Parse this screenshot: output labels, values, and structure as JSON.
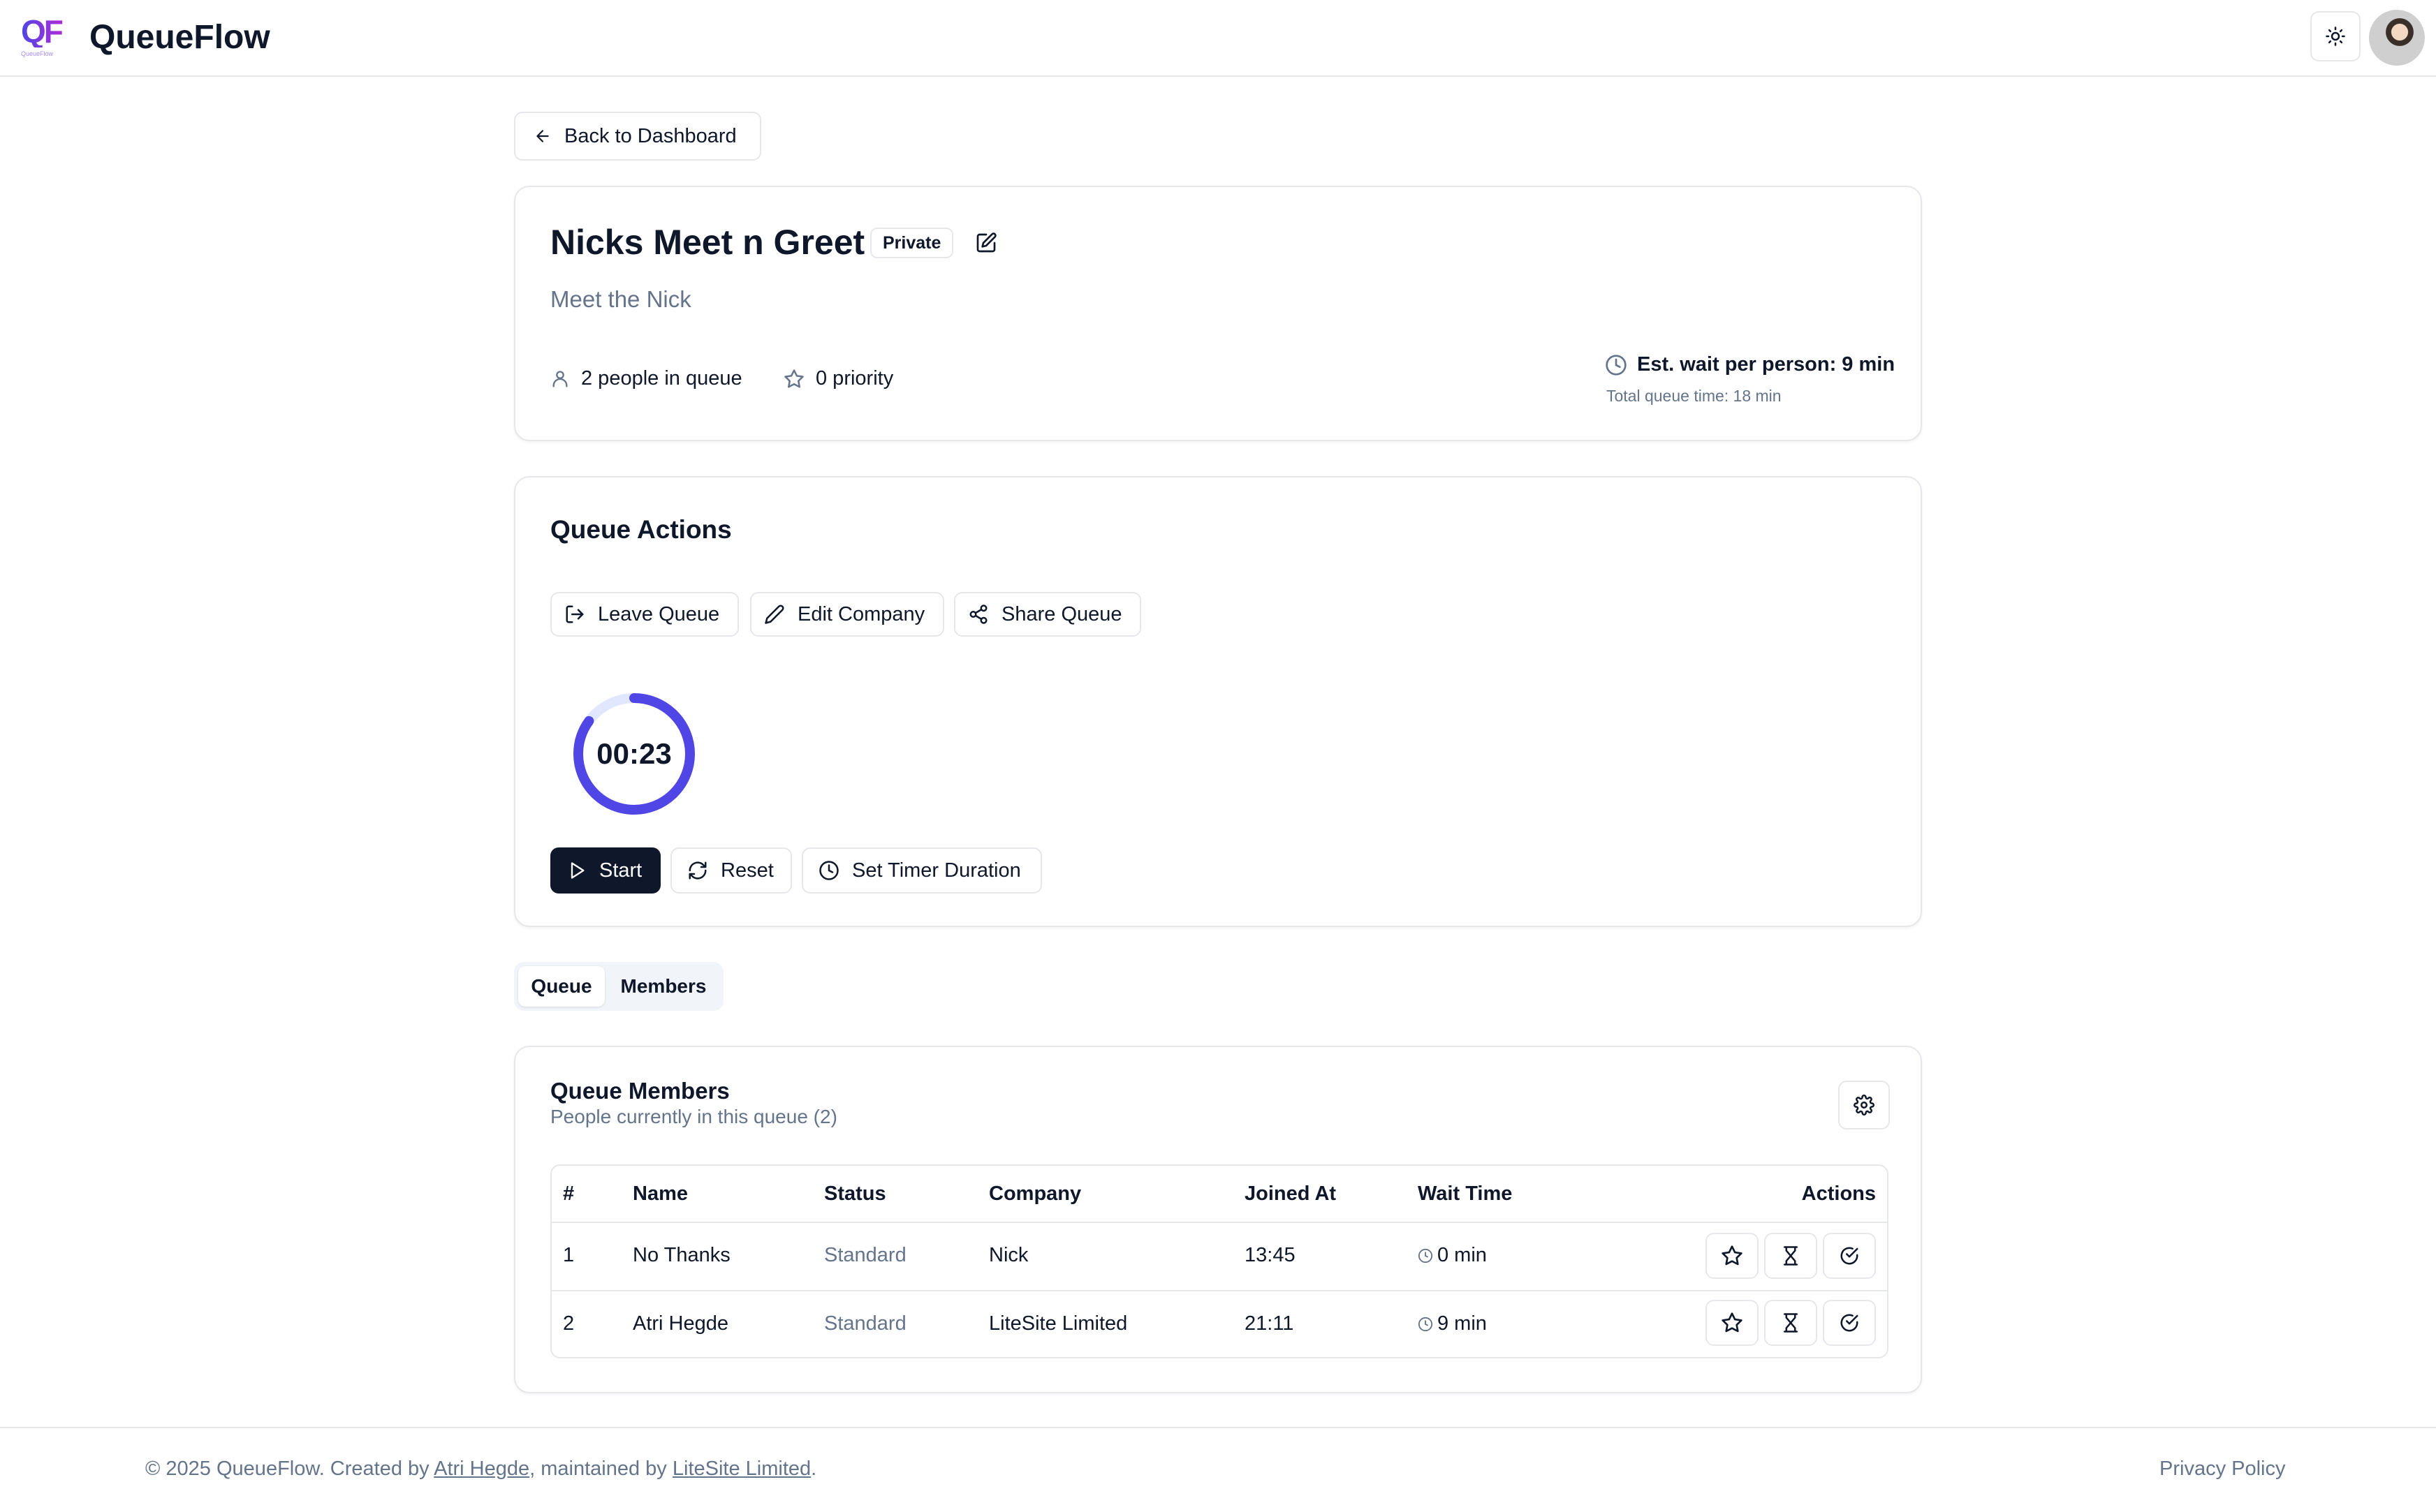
{
  "app": {
    "name": "QueueFlow",
    "logo_text": "QF",
    "logo_subtext": "QueueFlow"
  },
  "header": {
    "theme_icon": "sun-icon",
    "avatar": "user-avatar"
  },
  "nav": {
    "back_label": "Back to Dashboard"
  },
  "queue": {
    "title": "Nicks Meet n Greet",
    "visibility": "Private",
    "description": "Meet the Nick",
    "people_in_queue": "2 people in queue",
    "priority": "0 priority",
    "est_wait": "Est. wait per person: 9 min",
    "total_time": "Total queue time: 18 min"
  },
  "actions": {
    "title": "Queue Actions",
    "leave": "Leave Queue",
    "edit_company": "Edit Company",
    "share": "Share Queue",
    "timer_value": "00:23",
    "timer_progress": 0.85,
    "start": "Start",
    "reset": "Reset",
    "set_duration": "Set Timer Duration"
  },
  "tabs": [
    {
      "label": "Queue",
      "active": true
    },
    {
      "label": "Members",
      "active": false
    }
  ],
  "members": {
    "title": "Queue Members",
    "subtitle": "People currently in this queue (2)",
    "columns": [
      "#",
      "Name",
      "Status",
      "Company",
      "Joined At",
      "Wait Time",
      "Actions"
    ],
    "rows": [
      {
        "num": "1",
        "name": "No Thanks",
        "status": "Standard",
        "company": "Nick",
        "joined": "13:45",
        "wait": "0 min"
      },
      {
        "num": "2",
        "name": "Atri Hegde",
        "status": "Standard",
        "company": "LiteSite Limited",
        "joined": "21:11",
        "wait": "9 min"
      }
    ]
  },
  "footer": {
    "prefix": "© 2025 QueueFlow. Created by ",
    "author": "Atri Hegde",
    "middle": ", maintained by ",
    "maintainer": "LiteSite Limited",
    "suffix": ".",
    "privacy": "Privacy Policy"
  },
  "colors": {
    "accent": "#4f46e5",
    "accent_light": "#e0e7ff",
    "primary_button": "#0f172a",
    "muted_text": "#64748b",
    "border": "#e5e7eb"
  }
}
